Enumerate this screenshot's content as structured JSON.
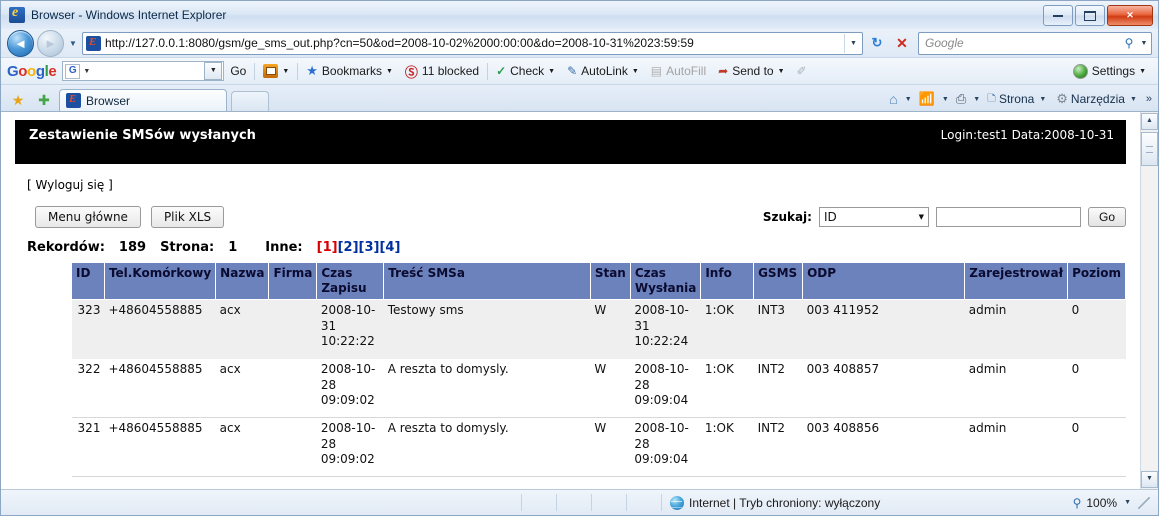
{
  "window": {
    "title": "Browser - Windows Internet Explorer",
    "minimize_label": "",
    "maximize_label": "",
    "close_label": "✕"
  },
  "navbar": {
    "back_label": "◄",
    "forward_label": "►",
    "history_caret": "▼",
    "url": "http://127.0.0.1:8080/gsm/ge_sms_out.php?cn=50&od=2008-10-02%2000:00:00&do=2008-10-31%2023:59:59",
    "address_caret": "▼",
    "refresh_label": "↻",
    "stop_label": "✕",
    "search_placeholder": "Google",
    "search_value": "",
    "search_magnifier": "search-icon",
    "search_caret": "▼"
  },
  "google_toolbar": {
    "logo": {
      "g1": "G",
      "o1": "o",
      "o2": "o",
      "g2": "g",
      "l": "l",
      "e": "e"
    },
    "search_value": "",
    "search_icon_letter": "G",
    "go_label": "Go",
    "items": [
      {
        "name": "popup-blocker",
        "label": "",
        "caret": "▼"
      },
      {
        "name": "bookmarks",
        "label": "Bookmarks",
        "caret": "▼"
      },
      {
        "name": "blocked-counter",
        "label": "11 blocked",
        "caret": ""
      },
      {
        "name": "spell-check",
        "label": "Check",
        "caret": "▼"
      },
      {
        "name": "autolink",
        "label": "AutoLink",
        "caret": "▼"
      },
      {
        "name": "autofill",
        "label": "AutoFill",
        "caret": ""
      },
      {
        "name": "send-to",
        "label": "Send to",
        "caret": "▼"
      },
      {
        "name": "highlight",
        "label": "",
        "caret": ""
      }
    ],
    "settings_label": "Settings",
    "settings_caret": "▼"
  },
  "tabbar": {
    "favorites_star": "★",
    "add_favorites_star": "✚",
    "tabs": [
      {
        "label": "Browser"
      }
    ],
    "command_items": [
      {
        "name": "home",
        "label": "",
        "caret": "▼"
      },
      {
        "name": "feeds",
        "label": "",
        "caret": "▼"
      },
      {
        "name": "print",
        "label": "",
        "caret": "▼"
      },
      {
        "name": "page",
        "label": "Strona",
        "caret": "▼"
      },
      {
        "name": "tools",
        "label": "Narzędzia",
        "caret": "▼"
      }
    ],
    "overflow": "»"
  },
  "page": {
    "banner": {
      "title": "Zestawienie SMSów wysłanych",
      "session": "Login:test1 Data:2008-10-31"
    },
    "logout_link": "[ Wyloguj się ]",
    "buttons": {
      "main_menu": "Menu główne",
      "xls_file": "Plik XLS"
    },
    "search": {
      "label": "Szukaj:",
      "selected_field": "ID",
      "select_caret": "▼",
      "input_value": "",
      "go_button": "Go"
    },
    "summary": {
      "records_label": "Rekordów:",
      "records_value": "189",
      "page_label": "Strona:",
      "page_value": "1",
      "other_label": "Inne:",
      "pages": [
        {
          "label": "[1]",
          "current": true
        },
        {
          "label": "[2]",
          "current": false
        },
        {
          "label": "[3]",
          "current": false
        },
        {
          "label": "[4]",
          "current": false
        }
      ]
    },
    "table": {
      "headers": [
        "ID",
        "Tel.Komórkowy",
        "Nazwa",
        "Firma",
        "Czas Zapisu",
        "Treść SMSa",
        "Stan",
        "Czas Wysłania",
        "Info",
        "GSMS",
        "ODP",
        "Zarejestrował",
        "Poziom"
      ],
      "rows": [
        {
          "id": "323",
          "tel": "+48604558885",
          "nazwa": "acx",
          "firma": "",
          "czas_zapisu": "2008-10-31 10:22:22",
          "tresc": "Testowy sms",
          "stan": "W",
          "czas_wyslania": "2008-10-31 10:22:24",
          "info": "1:OK",
          "gsms": "INT3",
          "odp": "003 411952",
          "zarejestrowal": "admin",
          "poziom": "0"
        },
        {
          "id": "322",
          "tel": "+48604558885",
          "nazwa": "acx",
          "firma": "",
          "czas_zapisu": "2008-10-28 09:09:02",
          "tresc": "A reszta to domysly.",
          "stan": "W",
          "czas_wyslania": "2008-10-28 09:09:04",
          "info": "1:OK",
          "gsms": "INT2",
          "odp": "003 408857",
          "zarejestrowal": "admin",
          "poziom": "0"
        },
        {
          "id": "321",
          "tel": "+48604558885",
          "nazwa": "acx",
          "firma": "",
          "czas_zapisu": "2008-10-28 09:09:02",
          "tresc": "A reszta to domysly.",
          "stan": "W",
          "czas_wyslania": "2008-10-28 09:09:04",
          "info": "1:OK",
          "gsms": "INT2",
          "odp": "003 408856",
          "zarejestrowal": "admin",
          "poziom": "0"
        }
      ]
    },
    "scrollbar": {
      "up": "▲",
      "down": "▼"
    }
  },
  "statusbar": {
    "zone_text": "Internet | Tryb chroniony: wyłączony",
    "zoom_level": "100%",
    "zoom_caret": "▼"
  },
  "colors": {
    "banner_bg": "#000000",
    "table_header_bg": "#6c82bd",
    "current_page": "#d60000",
    "other_page": "#00309e",
    "alt_row_bg": "#efefef"
  }
}
